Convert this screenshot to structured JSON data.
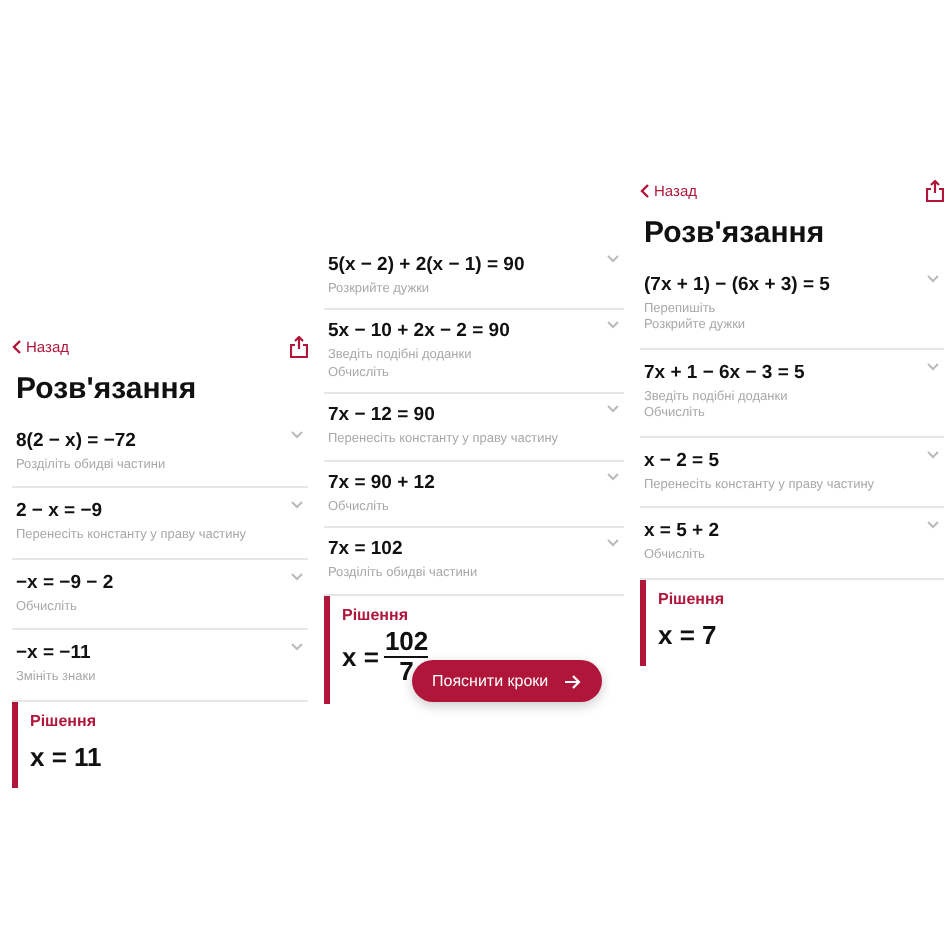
{
  "panels": [
    {
      "back": "Назад",
      "title": "Розв'язання",
      "steps": [
        {
          "equation": "8(2 − x) = −72",
          "hints": [
            "Розділіть обидві частини"
          ]
        },
        {
          "equation": "2 − x = −9",
          "hints": [
            "Перенесіть константу у праву частину"
          ]
        },
        {
          "equation": "−x = −9 − 2",
          "hints": [
            "Обчисліть"
          ]
        },
        {
          "equation": "−x = −11",
          "hints": [
            "Змініть знаки"
          ]
        }
      ],
      "solution": {
        "label": "Рішення",
        "kind": "plain",
        "answer": "x = 11"
      }
    },
    {
      "steps": [
        {
          "equation": "5(x − 2) + 2(x − 1) = 90",
          "hints": [
            "Розкрийте дужки"
          ]
        },
        {
          "equation": "5x − 10 + 2x − 2 = 90",
          "hints": [
            "Зведіть подібні доданки",
            "Обчисліть"
          ]
        },
        {
          "equation": "7x − 12 = 90",
          "hints": [
            "Перенесіть константу у праву частину"
          ]
        },
        {
          "equation": "7x = 90 + 12",
          "hints": [
            "Обчисліть"
          ]
        },
        {
          "equation": "7x = 102",
          "hints": [
            "Розділіть обидві частини"
          ]
        }
      ],
      "solution": {
        "label": "Рішення",
        "kind": "fraction",
        "answer": "x =",
        "numerator": "102",
        "denominator": "7"
      },
      "button": "Пояснити кроки"
    },
    {
      "back": "Назад",
      "title": "Розв'язання",
      "steps": [
        {
          "equation": "(7x + 1) − (6x + 3) = 5",
          "hints": [
            "Перепишіть",
            "Розкрийте дужки"
          ]
        },
        {
          "equation": "7x + 1 − 6x − 3 = 5",
          "hints": [
            "Зведіть подібні доданки",
            "Обчисліть"
          ]
        },
        {
          "equation": "x − 2 = 5",
          "hints": [
            "Перенесіть константу у праву частину"
          ]
        },
        {
          "equation": "x = 5 + 2",
          "hints": [
            "Обчисліть"
          ]
        }
      ],
      "solution": {
        "label": "Рішення",
        "kind": "plain",
        "answer": "x = 7"
      }
    }
  ]
}
